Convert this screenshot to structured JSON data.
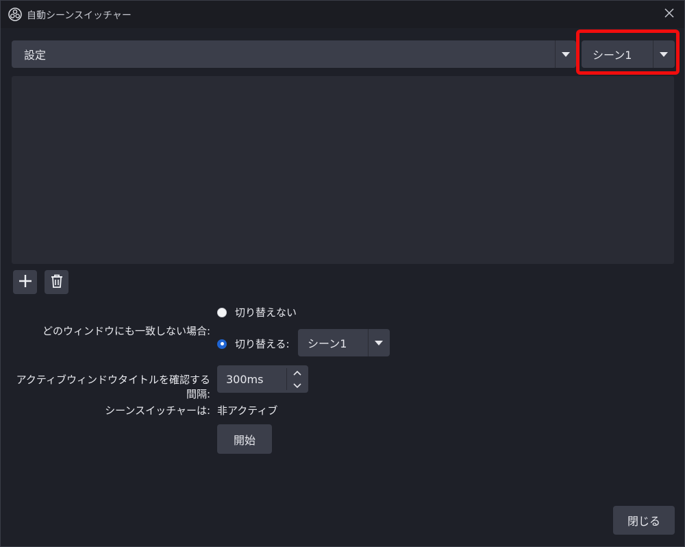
{
  "window": {
    "title": "自動シーンスイッチャー",
    "icon": "obs-logo-icon",
    "close_icon": "close-icon"
  },
  "top_bar": {
    "mode_combo": {
      "value": "設定"
    },
    "scene_combo": {
      "value": "シーン1"
    }
  },
  "toolbar": {
    "add_icon": "plus-icon",
    "delete_icon": "trash-icon"
  },
  "no_match": {
    "label": "どのウィンドウにも一致しない場合:",
    "option_dont_switch": "切り替えない",
    "option_switch": "切り替える:",
    "selected": "switch",
    "switch_scene_combo": {
      "value": "シーン1"
    }
  },
  "interval": {
    "label": "アクティブウィンドウタイトルを確認する間隔:",
    "value": "300ms"
  },
  "status": {
    "label": "シーンスイッチャーは:",
    "value": "非アクティブ"
  },
  "buttons": {
    "start": "開始",
    "close": "閉じる"
  },
  "colors": {
    "highlight": "#f10d0d",
    "radio_selected": "#1f64d2",
    "control_bg": "#3b3e4a",
    "window_bg": "#1e2028"
  }
}
